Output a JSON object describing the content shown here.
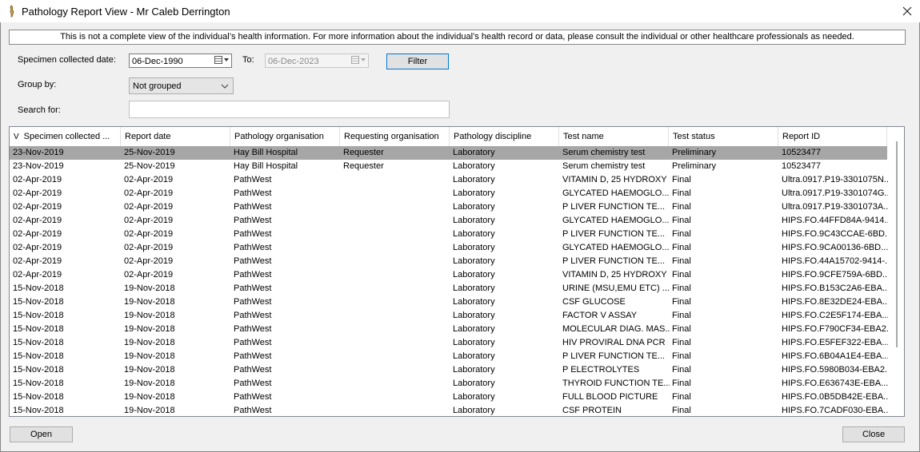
{
  "window": {
    "title": "Pathology Report View - Mr Caleb Derrington"
  },
  "disclaimer": "This is not a complete view of the individual’s health information. For more information about the individual’s health record or data, please consult the individual or other healthcare professionals as needed.",
  "filters": {
    "specimen_label": "Specimen collected date:",
    "from_date": "06-Dec-1990",
    "to_label": "To:",
    "to_date": "06-Dec-2023",
    "filter_button": "Filter",
    "group_by_label": "Group by:",
    "group_by_value": "Not grouped",
    "search_label": "Search for:",
    "search_value": "",
    "search_placeholder": ""
  },
  "table": {
    "sort_indicator": "V",
    "columns": [
      "Specimen collected ...",
      "Report date",
      "Pathology organisation",
      "Requesting organisation",
      "Pathology discipline",
      "Test name",
      "Test status",
      "Report ID"
    ],
    "rows": [
      [
        "23-Nov-2019",
        "25-Nov-2019",
        "Hay Bill Hospital",
        "Requester",
        "Laboratory",
        "Serum chemistry test",
        "Preliminary",
        "10523477"
      ],
      [
        "23-Nov-2019",
        "25-Nov-2019",
        "Hay Bill Hospital",
        "Requester",
        "Laboratory",
        "Serum chemistry test",
        "Preliminary",
        "10523477"
      ],
      [
        "02-Apr-2019",
        "02-Apr-2019",
        "PathWest",
        "",
        "Laboratory",
        "VITAMIN D, 25 HYDROXY",
        "Final",
        "Ultra.0917.P19-3301075N..."
      ],
      [
        "02-Apr-2019",
        "02-Apr-2019",
        "PathWest",
        "",
        "Laboratory",
        "GLYCATED HAEMOGLO...",
        "Final",
        "Ultra.0917.P19-3301074G..."
      ],
      [
        "02-Apr-2019",
        "02-Apr-2019",
        "PathWest",
        "",
        "Laboratory",
        "P LIVER FUNCTION TE...",
        "Final",
        "Ultra.0917.P19-3301073A..."
      ],
      [
        "02-Apr-2019",
        "02-Apr-2019",
        "PathWest",
        "",
        "Laboratory",
        "GLYCATED HAEMOGLO...",
        "Final",
        "HIPS.FO.44FFD84A-9414..."
      ],
      [
        "02-Apr-2019",
        "02-Apr-2019",
        "PathWest",
        "",
        "Laboratory",
        "P LIVER FUNCTION TE...",
        "Final",
        "HIPS.FO.9C43CCAE-6BD..."
      ],
      [
        "02-Apr-2019",
        "02-Apr-2019",
        "PathWest",
        "",
        "Laboratory",
        "GLYCATED HAEMOGLO...",
        "Final",
        "HIPS.FO.9CA00136-6BD..."
      ],
      [
        "02-Apr-2019",
        "02-Apr-2019",
        "PathWest",
        "",
        "Laboratory",
        "P LIVER FUNCTION TE...",
        "Final",
        "HIPS.FO.44A15702-9414-..."
      ],
      [
        "02-Apr-2019",
        "02-Apr-2019",
        "PathWest",
        "",
        "Laboratory",
        "VITAMIN D, 25 HYDROXY",
        "Final",
        "HIPS.FO.9CFE759A-6BD..."
      ],
      [
        "15-Nov-2018",
        "19-Nov-2018",
        "PathWest",
        "",
        "Laboratory",
        "URINE (MSU,EMU ETC) ...",
        "Final",
        "HIPS.FO.B153C2A6-EBA..."
      ],
      [
        "15-Nov-2018",
        "19-Nov-2018",
        "PathWest",
        "",
        "Laboratory",
        "CSF GLUCOSE",
        "Final",
        "HIPS.FO.8E32DE24-EBA..."
      ],
      [
        "15-Nov-2018",
        "19-Nov-2018",
        "PathWest",
        "",
        "Laboratory",
        "FACTOR V ASSAY",
        "Final",
        "HIPS.FO.C2E5F174-EBA..."
      ],
      [
        "15-Nov-2018",
        "19-Nov-2018",
        "PathWest",
        "",
        "Laboratory",
        "MOLECULAR DIAG. MAS...",
        "Final",
        "HIPS.FO.F790CF34-EBA2..."
      ],
      [
        "15-Nov-2018",
        "19-Nov-2018",
        "PathWest",
        "",
        "Laboratory",
        "HIV PROVIRAL DNA PCR",
        "Final",
        "HIPS.FO.E5FEF322-EBA..."
      ],
      [
        "15-Nov-2018",
        "19-Nov-2018",
        "PathWest",
        "",
        "Laboratory",
        "P LIVER FUNCTION TE...",
        "Final",
        "HIPS.FO.6B04A1E4-EBA..."
      ],
      [
        "15-Nov-2018",
        "19-Nov-2018",
        "PathWest",
        "",
        "Laboratory",
        "P ELECTROLYTES",
        "Final",
        "HIPS.FO.5980B034-EBA2..."
      ],
      [
        "15-Nov-2018",
        "19-Nov-2018",
        "PathWest",
        "",
        "Laboratory",
        "THYROID FUNCTION TE...",
        "Final",
        "HIPS.FO.E636743E-EBA..."
      ],
      [
        "15-Nov-2018",
        "19-Nov-2018",
        "PathWest",
        "",
        "Laboratory",
        "FULL BLOOD PICTURE",
        "Final",
        "HIPS.FO.0B5DB42E-EBA..."
      ],
      [
        "15-Nov-2018",
        "19-Nov-2018",
        "PathWest",
        "",
        "Laboratory",
        "CSF PROTEIN",
        "Final",
        "HIPS.FO.7CADF030-EBA..."
      ]
    ]
  },
  "footer": {
    "open_button": "Open",
    "close_button": "Close"
  },
  "colors": {
    "selected_row": "#a6a6a6",
    "focus_border": "#0078d7"
  },
  "icons": {
    "app": "app-icon",
    "close": "close-icon",
    "calendar": "calendar-icon",
    "dropdown": "chevron-down-icon"
  }
}
